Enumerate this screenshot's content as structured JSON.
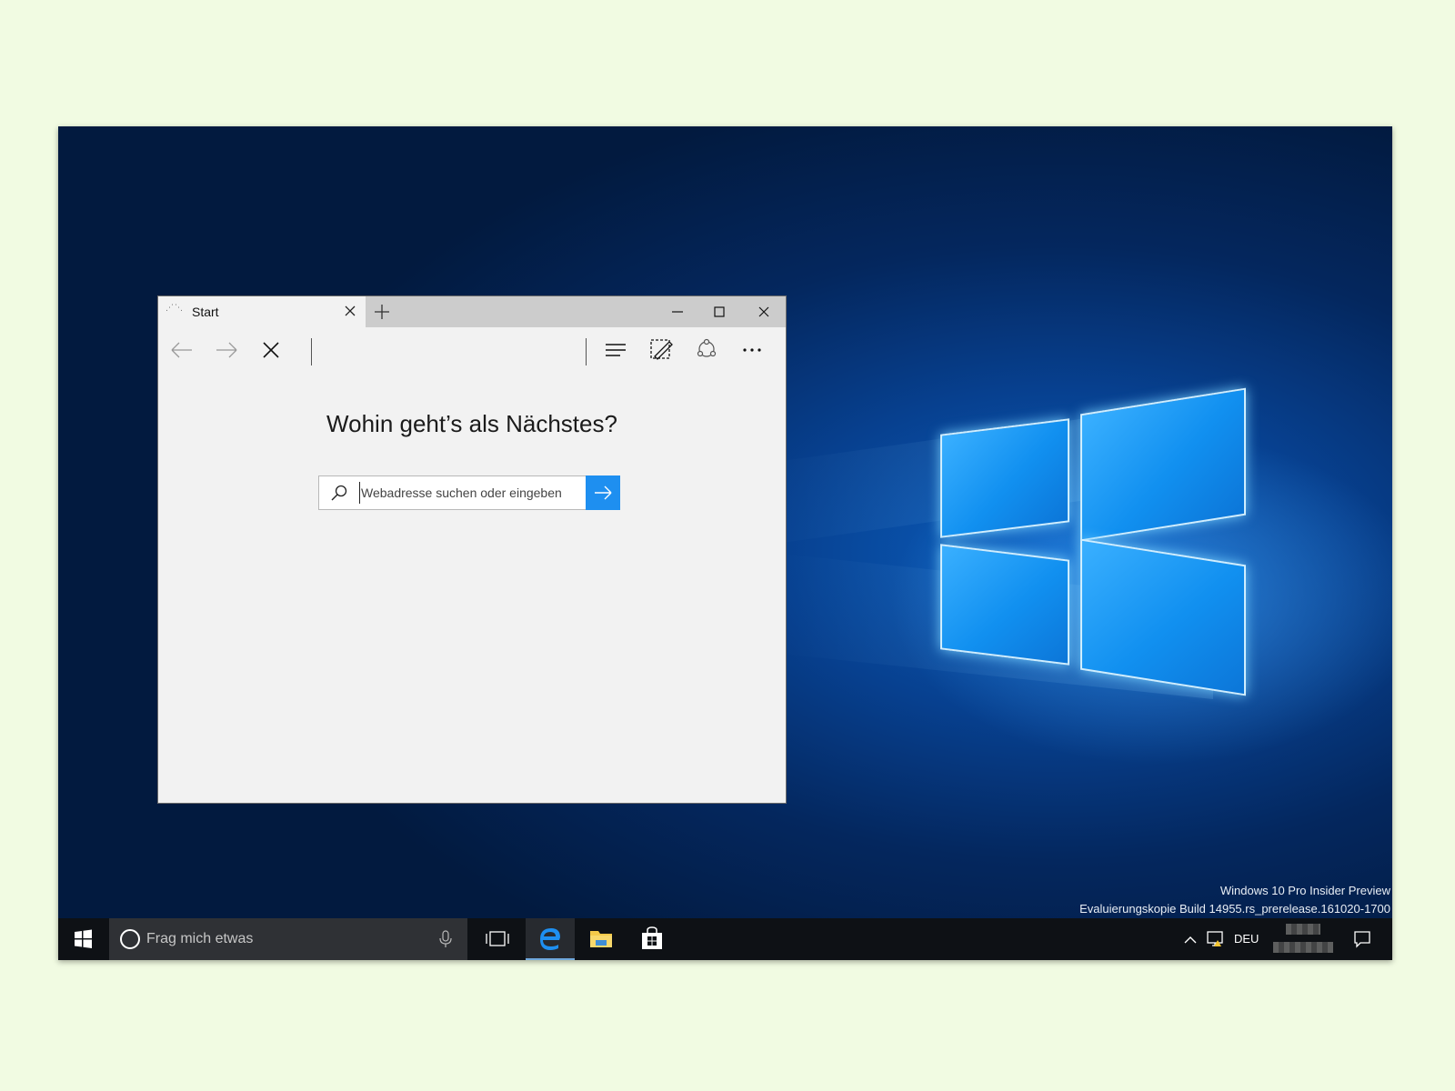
{
  "browser": {
    "tab_title": "Start",
    "headline": "Wohin geht’s als Nächstes?",
    "search_placeholder": "Webadresse suchen oder eingeben",
    "search_value": ""
  },
  "watermark": {
    "line1": "Windows 10 Pro Insider Preview",
    "line2": "Evaluierungskopie Build 14955.rs_prerelease.161020-1700"
  },
  "taskbar": {
    "search_placeholder": "Frag mich etwas",
    "pinned": [
      "task-view",
      "edge",
      "file-explorer",
      "store"
    ],
    "active_app": "edge",
    "language": "DEU"
  },
  "icons": [
    "back-arrow-icon",
    "forward-arrow-icon",
    "stop-icon",
    "hub-icon",
    "web-note-icon",
    "share-icon",
    "more-icon",
    "search-icon",
    "go-arrow-icon",
    "windows-logo-icon",
    "microphone-icon",
    "task-view-icon",
    "edge-icon",
    "folder-icon",
    "store-icon",
    "chevron-up-icon",
    "network-icon",
    "notification-icon"
  ],
  "colors": {
    "accent": "#1e8ff0",
    "titlebar": "#cccccc",
    "page_bg": "#f2f2f2",
    "taskbar": "#0e1115",
    "outer_bg": "#f1fbe2"
  }
}
